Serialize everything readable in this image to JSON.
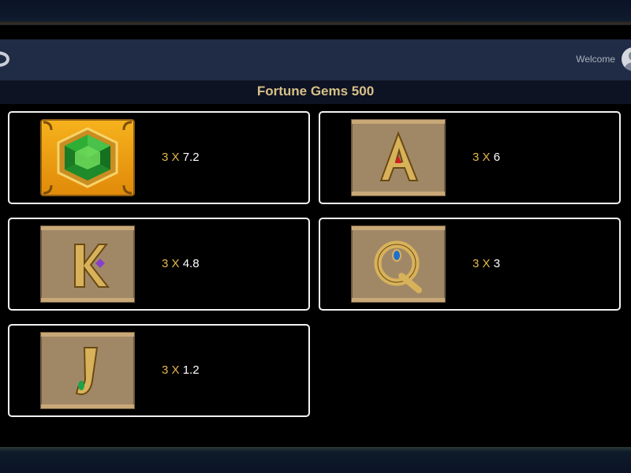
{
  "header": {
    "welcome_label": "Welcome"
  },
  "page": {
    "title": "Fortune Gems 500"
  },
  "paytable": [
    {
      "symbol": "green-gem",
      "count": "3",
      "times": "X",
      "multiplier": "7.2"
    },
    {
      "symbol": "letter-A",
      "count": "3",
      "times": "X",
      "multiplier": "6"
    },
    {
      "symbol": "letter-K",
      "count": "3",
      "times": "X",
      "multiplier": "4.8"
    },
    {
      "symbol": "letter-Q",
      "count": "3",
      "times": "X",
      "multiplier": "3"
    },
    {
      "symbol": "letter-J",
      "count": "3",
      "times": "X",
      "multiplier": "1.2"
    }
  ],
  "colors": {
    "gold": "#e6b94a",
    "title": "#d7c089",
    "header": "#202c45"
  }
}
